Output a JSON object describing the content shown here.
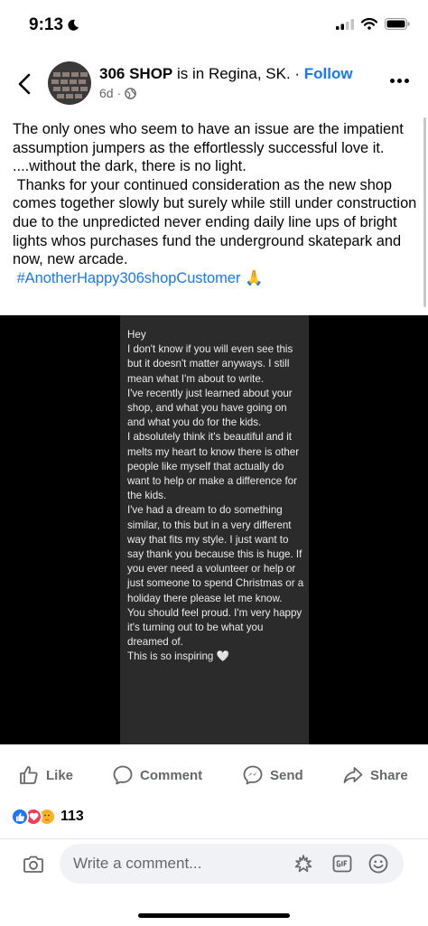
{
  "status_bar": {
    "time": "9:13",
    "icons": [
      "moon-icon",
      "signal-icon",
      "wifi-icon",
      "battery-icon"
    ]
  },
  "post_header": {
    "page_name": "306 SHOP",
    "location_text": " is in Regina, SK. · ",
    "follow_label": "Follow",
    "age": "6d ·",
    "privacy_icon": "globe-icon"
  },
  "post": {
    "body": "The only ones who seem to have an issue are the impatient assumption jumpers as the effortlessly successful love it.\n....without the dark, there is no light.\n Thanks for your continued consideration as the new shop comes together slowly but surely while still under construction due to the unpredicted never ending daily line ups of bright lights whos purchases fund the underground skatepark and now, new arcade.\n ",
    "hashtag": "#AnotherHappy306shopCustomer",
    "emoji": "🙏"
  },
  "image": {
    "message_text": "Hey\nI don't know if you will even see this but it doesn't matter anyways. I still mean what I'm about to write.\nI've recently just learned about your shop, and what you have going on and what you do for the kids.\nI absolutely think it's beautiful and it melts my heart to know there is other people like myself that actually do want to help or make a difference for the kids.\nI've had a dream to do something similar, to this but in a very different way that fits my style. I just want to say thank you because this is huge. If you ever need a volunteer or help or just someone to spend Christmas or a holiday there please let me know.\nYou should feel proud. I'm very happy it's turning out to be what you dreamed of.\nThis is so inspiring 🤍"
  },
  "actions": {
    "like": "Like",
    "comment": "Comment",
    "send": "Send",
    "share": "Share"
  },
  "reactions": {
    "types": [
      "like",
      "love",
      "care"
    ],
    "count": "113",
    "colors": {
      "like": "#1877f2",
      "love": "#f33e58",
      "care": "#f7b125"
    }
  },
  "comment_bar": {
    "placeholder": "Write a comment...",
    "icons": [
      "camera-icon",
      "avatar-sticker-icon",
      "gif-icon",
      "emoji-icon"
    ]
  },
  "colors": {
    "accent": "#1877f2",
    "secondary_text": "#65676b",
    "input_bg": "#f0f2f5",
    "image_bg": "#000000",
    "message_bg": "#2b2b2b"
  }
}
